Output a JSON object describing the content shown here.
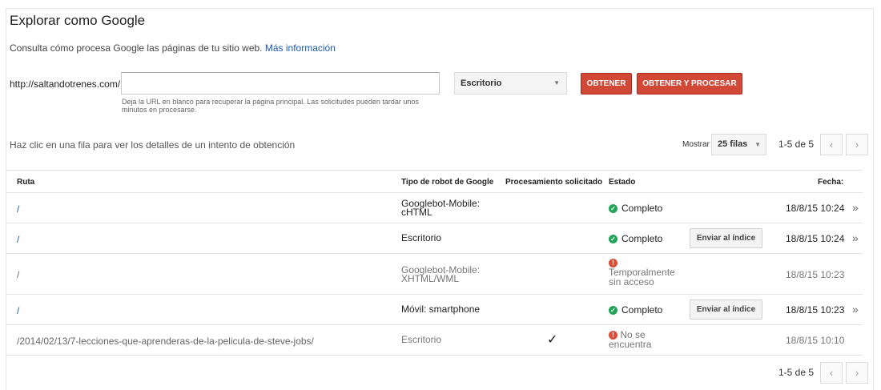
{
  "page": {
    "title": "Explorar como Google",
    "description": "Consulta cómo procesa Google las páginas de tu sitio web.",
    "more_info": "Más información"
  },
  "fetch_form": {
    "url_prefix": "http://saltandotrenes.com/",
    "url_value": "",
    "hint": "Deja la URL en blanco para recuperar la página principal. Las solicitudes pueden tardar unos minutos en procesarse.",
    "device_selected": "Escritorio",
    "fetch_button": "OBTENER",
    "fetch_render_button": "OBTENER Y PROCESAR"
  },
  "list": {
    "hint": "Haz clic en una fila para ver los detalles de un intento de obtención",
    "show_label": "Mostrar",
    "rows_selected": "25 filas",
    "pagination": "1-5 de 5",
    "prev_icon": "chevron-left-icon",
    "next_icon": "chevron-right-icon"
  },
  "table": {
    "headers": {
      "ruta": "Ruta",
      "robot": "Tipo de robot de Google",
      "render": "Procesamiento solicitado",
      "estado": "Estado",
      "fecha": "Fecha:"
    },
    "rows": [
      {
        "ruta": "/",
        "robot": "Googlebot-Mobile: cHTML",
        "render": "",
        "estado": "Completo",
        "status_type": "ok",
        "action": "",
        "fecha": "18/8/15 10:24",
        "chevron": "»"
      },
      {
        "ruta": "/",
        "robot": "Escritorio",
        "render": "",
        "estado": "Completo",
        "status_type": "ok",
        "action": "Enviar al índice",
        "fecha": "18/8/15 10:24",
        "chevron": "»"
      },
      {
        "ruta": "/",
        "robot": "Googlebot-Mobile: XHTML/WML",
        "render": "",
        "estado": "Temporalmente sin acceso",
        "status_type": "error",
        "action": "",
        "fecha": "18/8/15 10:23",
        "chevron": ""
      },
      {
        "ruta": "/",
        "robot": "Móvil: smartphone",
        "render": "",
        "estado": "Completo",
        "status_type": "ok",
        "action": "Enviar al índice",
        "fecha": "18/8/15 10:23",
        "chevron": "»"
      },
      {
        "ruta": "/2014/02/13/7-lecciones-que-aprenderas-de-la-pelicula-de-steve-jobs/",
        "robot": "Escritorio",
        "render": "✓",
        "estado": "No se encuentra",
        "status_type": "error",
        "action": "",
        "fecha": "18/8/15 10:10",
        "chevron": ""
      }
    ]
  },
  "colors": {
    "accent_red": "#d14836",
    "link_blue": "#1a5ab5",
    "ok_green": "#21a35a",
    "error_red": "#dd4b39"
  }
}
